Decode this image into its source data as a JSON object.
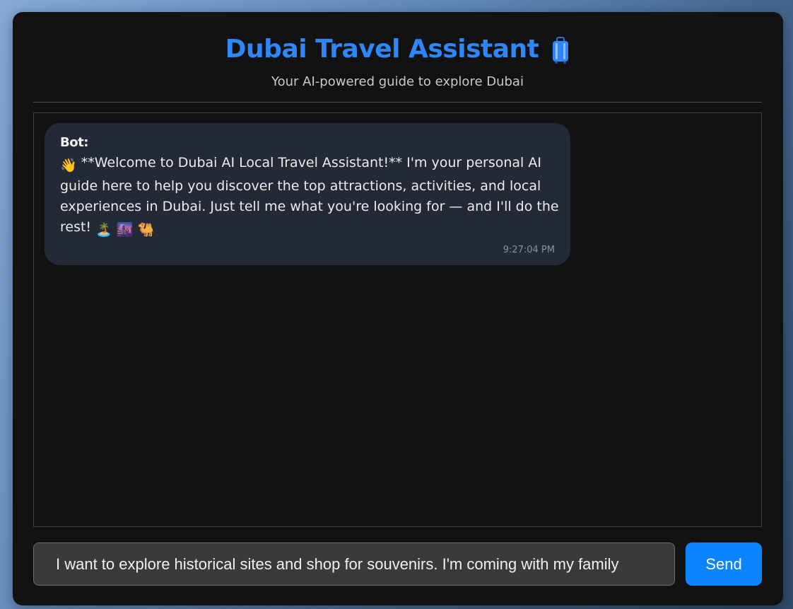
{
  "header": {
    "title": "Dubai Travel Assistant",
    "title_icon": "luggage-icon",
    "subtitle": "Your AI-powered guide to explore Dubai"
  },
  "chat": {
    "messages": [
      {
        "sender": "Bot:",
        "lead_emoji": "👋",
        "text": "**Welcome to Dubai AI Local Travel Assistant!** I'm your personal AI guide here to help you discover the top attractions, activities, and local experiences in Dubai. Just tell me what you're looking for — and I'll do the rest!",
        "trail_emojis": "🏝️ 🌆 🐫",
        "time": "9:27:04 PM"
      }
    ]
  },
  "composer": {
    "input_value": "I want to explore historical sites and shop for souvenirs. I'm coming with my family",
    "send_label": "Send"
  },
  "colors": {
    "accent": "#2f86f6",
    "send_button": "#0a84ff",
    "panel_bg": "#121212",
    "bubble_bg": "#232a36"
  }
}
